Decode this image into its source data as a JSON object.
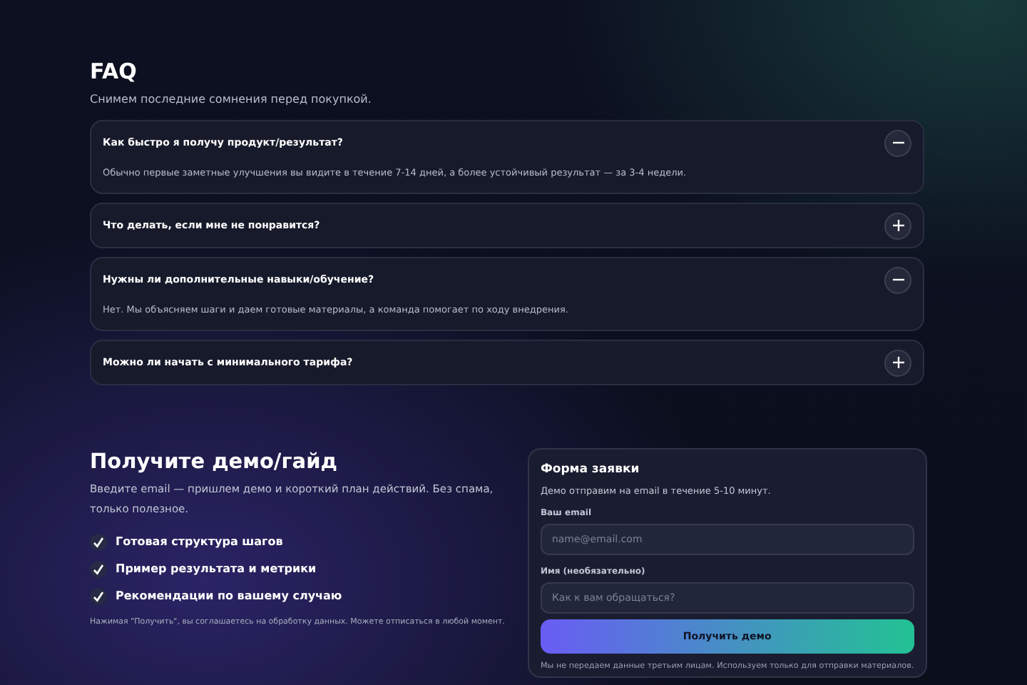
{
  "faq": {
    "title": "FAQ",
    "subtitle": "Снимем последние сомнения перед покупкой.",
    "items": [
      {
        "question": "Как быстро я получу продукт/результат?",
        "answer": "Обычно первые заметные улучшения вы видите в течение 7-14 дней, а более устойчивый результат — за 3-4 недели.",
        "expanded": true
      },
      {
        "question": "Что делать, если мне не понравится?",
        "expanded": false
      },
      {
        "question": "Нужны ли дополнительные навыки/обучение?",
        "answer": "Нет. Мы объясняем шаги и даем готовые материалы, а команда помогает по ходу внедрения.",
        "expanded": true
      },
      {
        "question": "Можно ли начать с минимального тарифа?",
        "expanded": false
      }
    ]
  },
  "demo": {
    "title": "Получите демо/гайд",
    "lead": "Введите email — пришлем демо и короткий план действий. Без спама, только полезное.",
    "benefits": [
      "Готовая структура шагов",
      "Пример результата и метрики",
      "Рекомендации по вашему случаю"
    ],
    "consent": "Нажимая \"Получить\", вы соглашаетесь на обработку данных. Можете отписаться в любой момент."
  },
  "form": {
    "title": "Форма заявки",
    "subtitle": "Демо отправим на email в течение 5-10 минут.",
    "fields": [
      {
        "label": "Ваш email",
        "placeholder": "name@email.com"
      },
      {
        "label": "Имя (необязательно)",
        "placeholder": "Как к вам обращаться?"
      }
    ],
    "submit": "Получить демо",
    "note": "Мы не передаем данные третьим лицам. Используем только для отправки материалов."
  }
}
